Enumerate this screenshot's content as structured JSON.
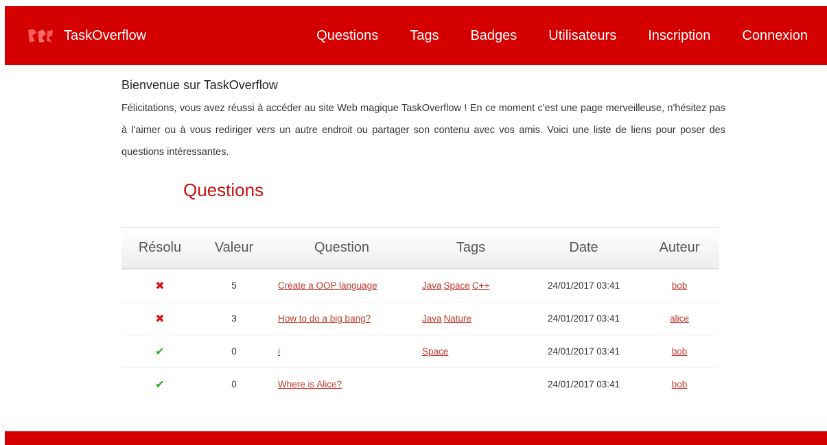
{
  "navbar": {
    "brand": "TaskOverflow",
    "links": [
      "Questions",
      "Tags",
      "Badges",
      "Utilisateurs",
      "Inscription",
      "Connexion"
    ],
    "color": "#d40000"
  },
  "intro": {
    "title": "Bienvenue sur TaskOverflow",
    "text": "Félicitations, vous avez réussi à accéder au site Web magique TaskOverflow ! En ce moment c'est une page merveilleuse, n'hésitez pas à l'aimer ou à vous rediriger vers un autre endroit ou partager son contenu avec vos amis. Voici une liste de liens pour poser des questions intéressantes."
  },
  "questions": {
    "title": "Questions",
    "columns": [
      "Résolu",
      "Valeur",
      "Question",
      "Tags",
      "Date",
      "Auteur"
    ],
    "rows": [
      {
        "resolved": false,
        "resolved_icon": "✖",
        "value": "5",
        "question": "Create a OOP language",
        "tags": [
          "Java",
          "Space",
          "C++"
        ],
        "date": "24/01/2017 03:41",
        "author": "bob"
      },
      {
        "resolved": false,
        "resolved_icon": "✖",
        "value": "3",
        "question": "How to do a big bang?",
        "tags": [
          "Java",
          "Nature"
        ],
        "date": "24/01/2017 03:41",
        "author": "alice"
      },
      {
        "resolved": true,
        "resolved_icon": "✔",
        "value": "0",
        "question": "i",
        "tags": [
          "Space"
        ],
        "date": "24/01/2017 03:41",
        "author": "bob"
      },
      {
        "resolved": true,
        "resolved_icon": "✔",
        "value": "0",
        "question": "Where is Alice?",
        "tags": [],
        "date": "24/01/2017 03:41",
        "author": "bob"
      }
    ]
  },
  "colors": {
    "accent": "#d40000",
    "title_red": "#c81010",
    "link": "#c0392b",
    "resolved_no": "#e10e0e",
    "resolved_yes": "#22b022"
  }
}
